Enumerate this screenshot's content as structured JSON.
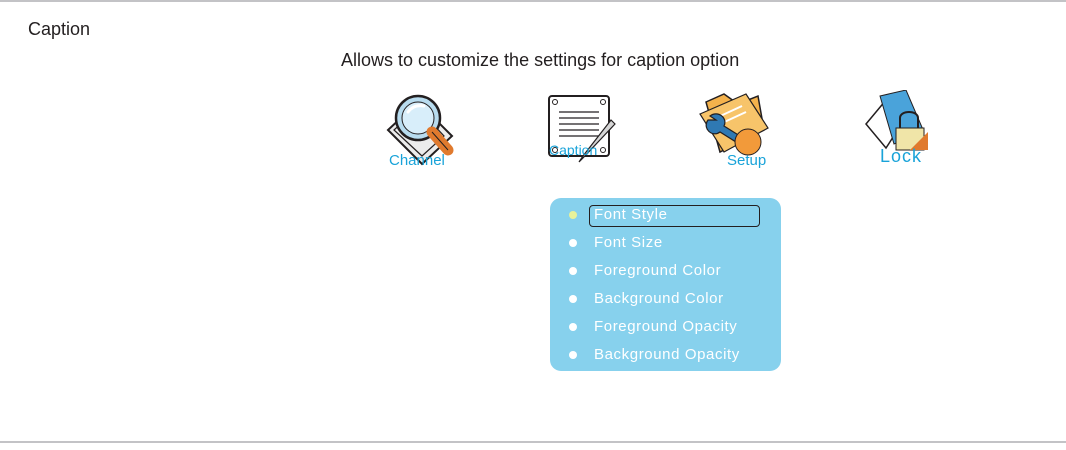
{
  "page": {
    "section_title": "Caption",
    "description": "Allows to customize the settings for caption option"
  },
  "icons": [
    {
      "label": "Channel",
      "icon": "magnifier-icon"
    },
    {
      "label": "Caption",
      "icon": "notepad-pen-icon"
    },
    {
      "label": "Setup",
      "icon": "folder-wrench-icon"
    },
    {
      "label": "Lock",
      "icon": "padlock-icon"
    }
  ],
  "menu": {
    "selected_index": 0,
    "items": [
      {
        "label": "Font Style"
      },
      {
        "label": "Font Size"
      },
      {
        "label": "Foreground Color"
      },
      {
        "label": "Background Color"
      },
      {
        "label": "Foreground Opacity"
      },
      {
        "label": "Background Opacity"
      }
    ]
  },
  "colors": {
    "menu_background": "#87d1ed",
    "icon_label": "#19a3d9",
    "selected_bullet": "#e8f29a",
    "rule": "#c3c3c6"
  }
}
